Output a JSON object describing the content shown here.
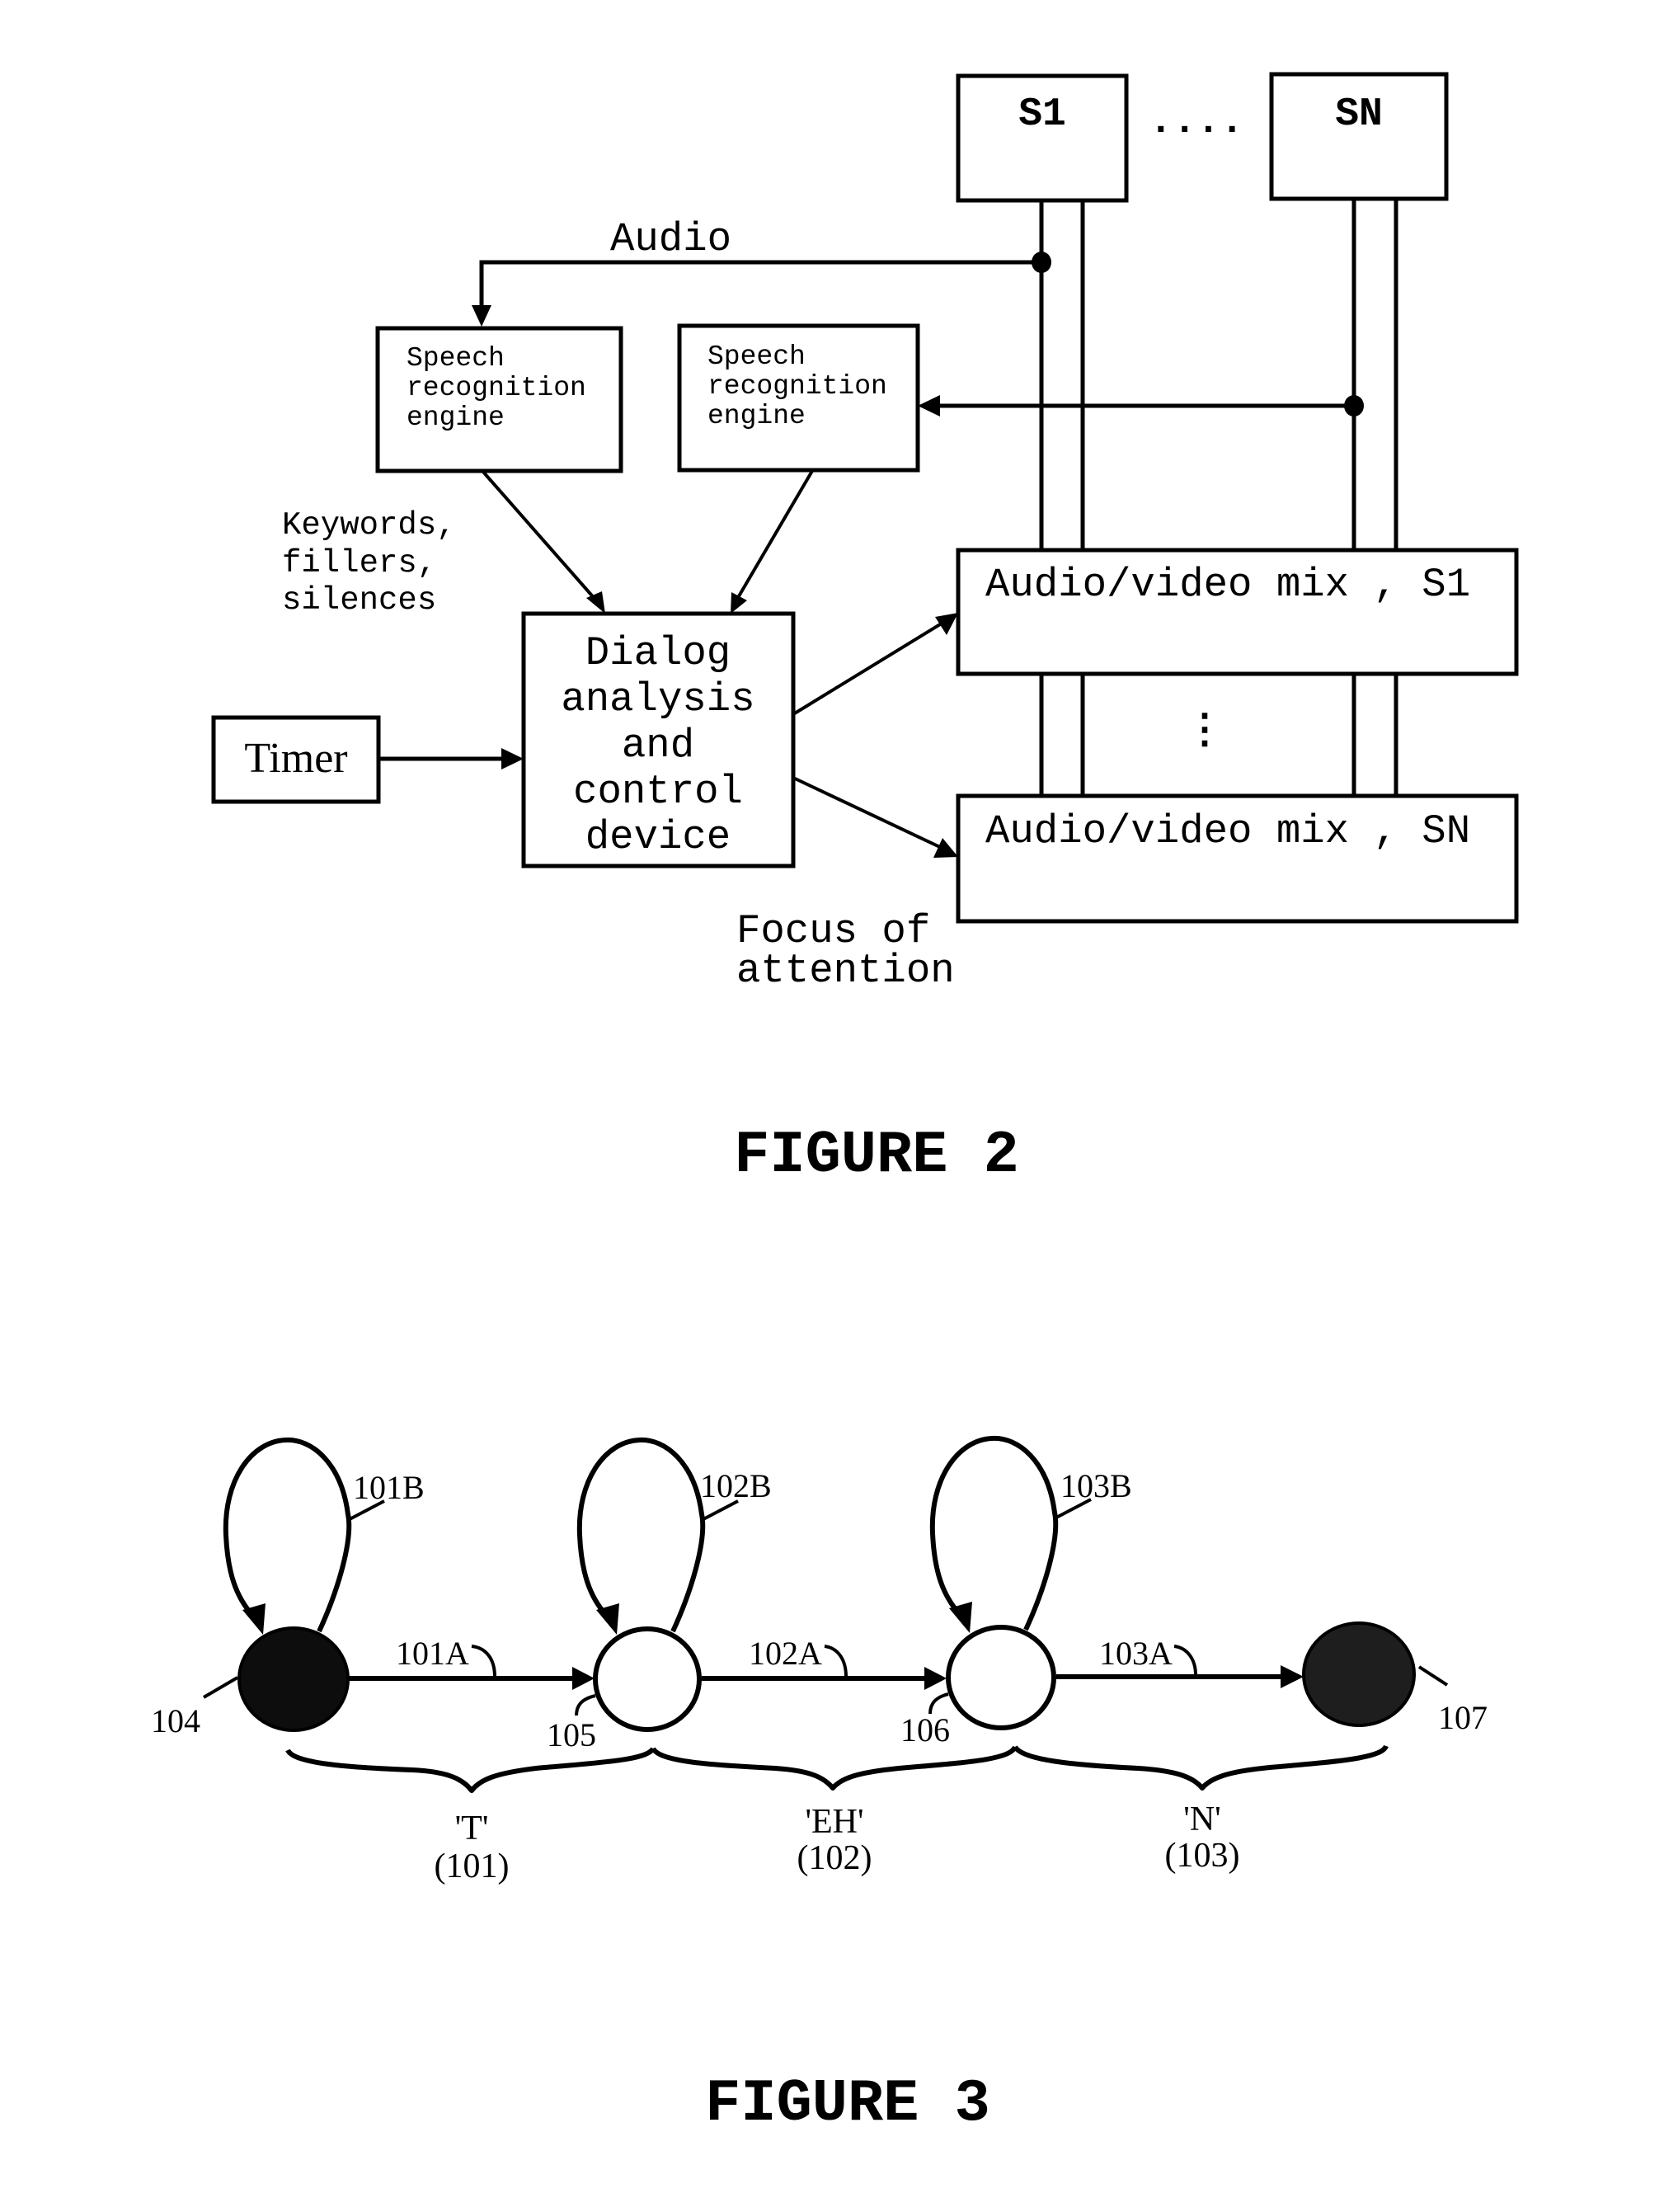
{
  "figure2": {
    "caption": "FIGURE 2",
    "sources": [
      {
        "id": "S1",
        "label": "S1"
      },
      {
        "id": "SN",
        "label": "SN"
      }
    ],
    "source_ellipsis": "....",
    "audio_label": "Audio",
    "speech_engine_1": {
      "lines": [
        "Speech",
        "recognition",
        "engine"
      ]
    },
    "speech_engine_2": {
      "lines": [
        "Speech",
        "recognition",
        "engine"
      ]
    },
    "keywords_label": {
      "lines": [
        "Keywords,",
        "fillers,",
        "silences"
      ]
    },
    "dialog_box": {
      "lines": [
        "Dialog",
        "analysis",
        "and",
        "control",
        "device"
      ]
    },
    "timer_label": "Timer",
    "mix_s1_label": "Audio/video mix , S1",
    "mix_sn_label": "Audio/video mix , SN",
    "mix_ellipsis": "⋮",
    "focus_label": {
      "lines": [
        "Focus of",
        "attention"
      ]
    }
  },
  "figure3": {
    "caption": "FIGURE 3",
    "nodes": [
      {
        "id": "104",
        "label": "104",
        "type": "start"
      },
      {
        "id": "105",
        "label": "105",
        "type": "intermediate"
      },
      {
        "id": "106",
        "label": "106",
        "type": "intermediate"
      },
      {
        "id": "107",
        "label": "107",
        "type": "end"
      }
    ],
    "self_loops": [
      {
        "label": "101B"
      },
      {
        "label": "102B"
      },
      {
        "label": "103B"
      }
    ],
    "transitions": [
      {
        "label": "101A",
        "from": "104",
        "to": "105"
      },
      {
        "label": "102A",
        "from": "105",
        "to": "106"
      },
      {
        "label": "103A",
        "from": "106",
        "to": "107"
      }
    ],
    "phonemes": [
      {
        "symbol": "'T'",
        "ref": "(101)"
      },
      {
        "symbol": "'EH'",
        "ref": "(102)"
      },
      {
        "symbol": "'N'",
        "ref": "(103)"
      }
    ]
  }
}
